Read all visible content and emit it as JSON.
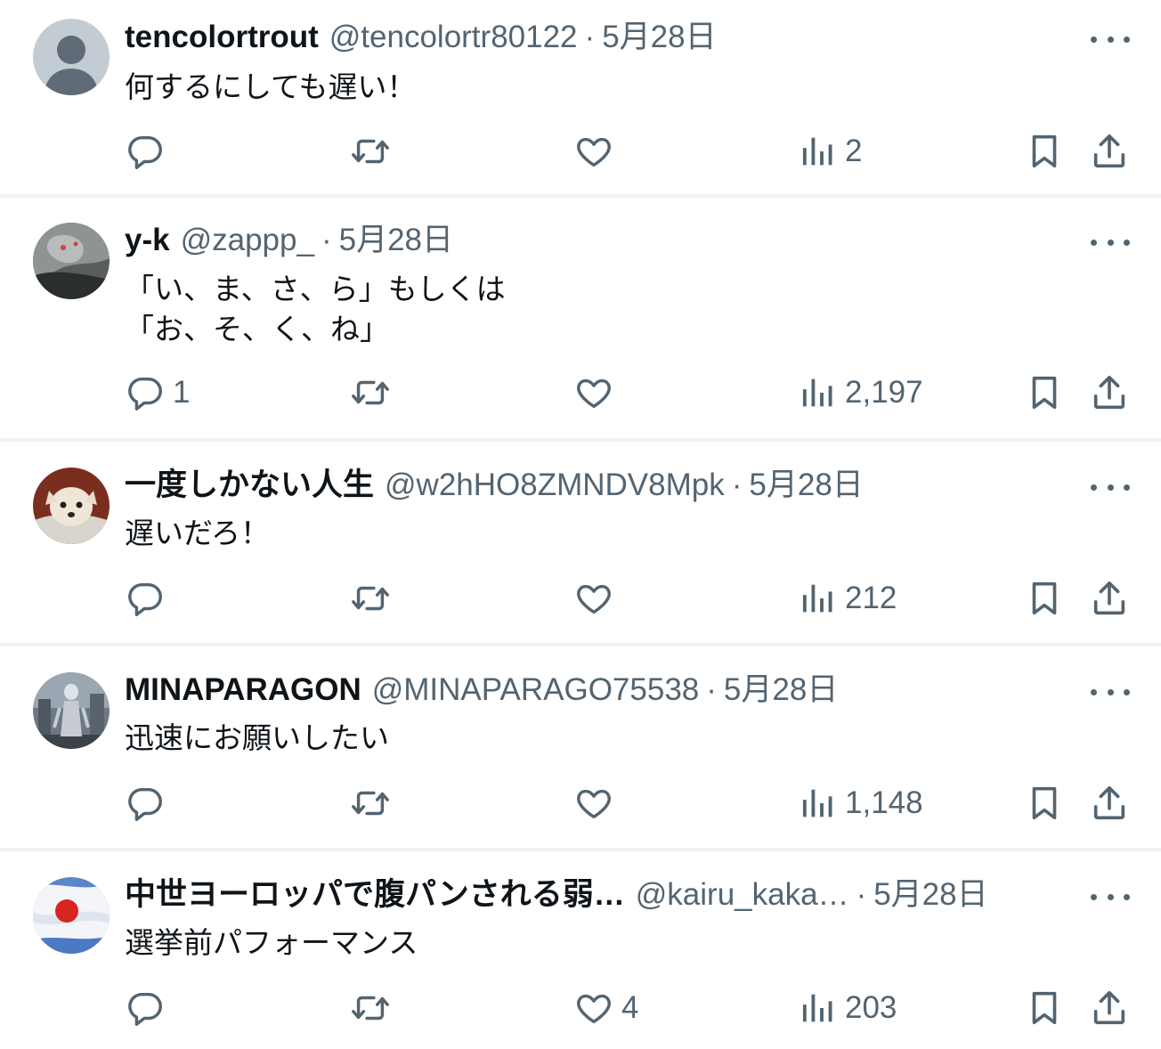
{
  "colors": {
    "text_primary": "#0f1419",
    "text_secondary": "#536471",
    "divider": "#eff3f4",
    "background": "#ffffff"
  },
  "icons": {
    "reply": "reply-icon",
    "retweet": "retweet-icon",
    "like": "heart-icon",
    "views": "views-icon",
    "bookmark": "bookmark-icon",
    "share": "share-icon",
    "more": "more-icon"
  },
  "tweets": [
    {
      "name": "tencolortrout",
      "handle": "@tencolortr80122",
      "separator": "·",
      "date": "5月28日",
      "text": "何するにしても遅い！",
      "replies": "",
      "retweets": "",
      "likes": "",
      "views": "2"
    },
    {
      "name": "y-k",
      "handle": "@zappp_",
      "separator": "·",
      "date": "5月28日",
      "text": "「い、ま、さ、ら」もしくは\n「お、そ、く、ね」",
      "replies": "1",
      "retweets": "",
      "likes": "",
      "views": "2,197"
    },
    {
      "name": "一度しかない人生",
      "handle": "@w2hHO8ZMNDV8Mpk",
      "separator": "·",
      "date": "5月28日",
      "text": "遅いだろ！",
      "replies": "",
      "retweets": "",
      "likes": "",
      "views": "212"
    },
    {
      "name": "MINAPARAGON",
      "handle": "@MINAPARAGO75538",
      "separator": "·",
      "date": "5月28日",
      "text": "迅速にお願いしたい",
      "replies": "",
      "retweets": "",
      "likes": "",
      "views": "1,148"
    },
    {
      "name": "中世ヨーロッパで腹パンされる弱…",
      "handle": "@kairu_kaka…",
      "separator": "·",
      "date": "5月28日",
      "text": "選挙前パフォーマンス",
      "replies": "",
      "retweets": "",
      "likes": "4",
      "views": "203"
    }
  ]
}
